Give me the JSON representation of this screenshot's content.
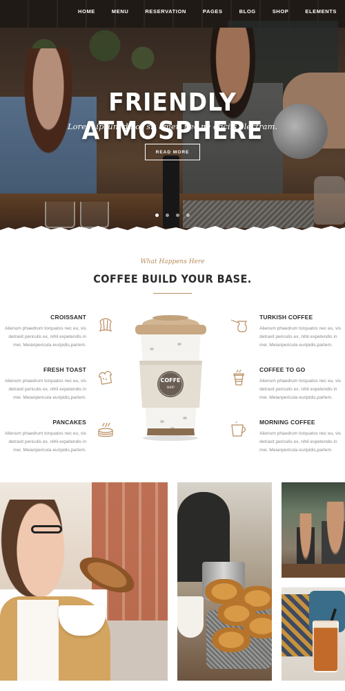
{
  "nav": {
    "items": [
      "HOME",
      "MENU",
      "RESERVATION",
      "PAGES",
      "BLOG",
      "SHOP",
      "ELEMENTS"
    ]
  },
  "hero": {
    "title": "FRIENDLY ATMOSPHERE",
    "subtitle": "Lorem ipsum dolor sit amet, nec ne oficiis electram.",
    "button_label": "READ MORE",
    "slide_count": 4,
    "active_slide": 1
  },
  "section": {
    "eyebrow": "What Happens Here",
    "title": "COFFEE BUILD YOUR BASE."
  },
  "features": {
    "left": [
      {
        "title": "CROISSANT",
        "text": "Alienum phaedrum torquatos nec eu, vis detraxit periculis ex, nihil expetendis in mei. Meianpericula euripidis,partem.",
        "icon": "croissant-icon"
      },
      {
        "title": "FRESH TOAST",
        "text": "Alienum phaedrum torquatos nec eu, vis detraxit periculis ex, nihil expetendis in mei. Meianpericula euripidis,partem.",
        "icon": "toast-icon"
      },
      {
        "title": "PANCAKES",
        "text": "Alienum phaedrum torquatos nec eu, vis detraxit periculis ex, nihil expetendis in mei. Meianpericula euripidis,partem.",
        "icon": "pancakes-icon"
      }
    ],
    "right": [
      {
        "title": "TURKISH COFFEE",
        "text": "Alienum phaedrum torquatos nec eu, vis detraxit periculis ex, nihil expetendis in mei. Meianpericula euripidis,partem.",
        "icon": "turkish-coffee-pot-icon"
      },
      {
        "title": "COFFEE TO GO",
        "text": "Alienum phaedrum torquatos nec eu, vis detraxit periculis ex, nihil expetendis in mei. Meianpericula euripidis,partem.",
        "icon": "takeaway-cup-icon"
      },
      {
        "title": "MORNING COFFEE",
        "text": "Alienum phaedrum torquatos nec eu, vis detraxit periculis ex, nihil expetendis in mei. Meianpericula euripidis,partem.",
        "icon": "coffee-mug-icon"
      }
    ]
  },
  "cup": {
    "label_main": "COFFE",
    "label_sub": "SHOP"
  },
  "colors": {
    "accent": "#b78c5d",
    "heading": "#2b2b2b",
    "body_text": "#8a8a8a"
  }
}
